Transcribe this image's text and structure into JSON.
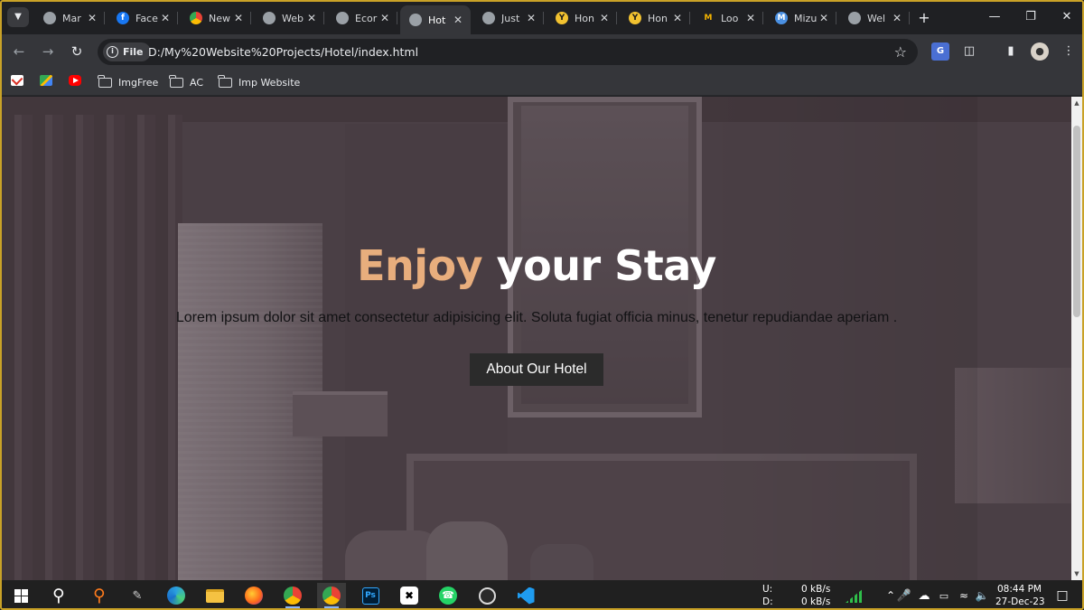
{
  "browser": {
    "tabs": [
      {
        "title": "Mar",
        "icon": "globe-icon",
        "active": false
      },
      {
        "title": "Face",
        "icon": "facebook-icon",
        "active": false
      },
      {
        "title": "New",
        "icon": "chrome-icon",
        "active": false
      },
      {
        "title": "Web",
        "icon": "globe-icon",
        "active": false
      },
      {
        "title": "Ecor",
        "icon": "globe-icon",
        "active": false
      },
      {
        "title": "Hot",
        "icon": "globe-icon",
        "active": true
      },
      {
        "title": "Just",
        "icon": "globe-icon",
        "active": false
      },
      {
        "title": "Hon",
        "icon": "y-logo-icon",
        "active": false
      },
      {
        "title": "Hon",
        "icon": "y-logo-icon",
        "active": false
      },
      {
        "title": "Loo",
        "icon": "m-logo-icon",
        "active": false
      },
      {
        "title": "Mizu",
        "icon": "m-circle-icon",
        "active": false
      },
      {
        "title": "Wel",
        "icon": "globe-icon",
        "active": false
      }
    ],
    "address": {
      "scheme_chip": "File",
      "url": "D:/My%20Website%20Projects/Hotel/index.html"
    },
    "bookmarks": [
      {
        "label": "ImgFree",
        "icon": "folder-icon"
      },
      {
        "label": "AC",
        "icon": "folder-icon"
      },
      {
        "label": "Imp Website",
        "icon": "folder-icon"
      }
    ],
    "bookmark_app_icons": [
      "gmail-icon",
      "google-maps-icon",
      "youtube-icon"
    ]
  },
  "page": {
    "hero": {
      "title_accent": "Enjoy",
      "title_rest": " your Stay",
      "subtitle": "Lorem ipsum dolor sit amet consectetur adipisicing elit. Soluta fugiat officia minus, tenetur repudiandae aperiam .",
      "button_label": "About Our Hotel"
    },
    "colors": {
      "accent": "#e8ae7d",
      "overlay": "#4d4449",
      "button_bg": "#2b2b2b"
    }
  },
  "taskbar": {
    "apps": [
      "start-icon",
      "search-icon",
      "magnifier-app-icon",
      "pen-icon",
      "edge-icon",
      "file-explorer-icon",
      "firefox-icon",
      "chrome-icon",
      "chrome-profile-icon",
      "photoshop-icon",
      "capcut-icon",
      "whatsapp-icon",
      "obs-icon",
      "vscode-icon"
    ],
    "network": {
      "upload_label": "U:",
      "download_label": "D:",
      "upload_value": "0 kB/s",
      "download_value": "0 kB/s"
    },
    "clock": {
      "time": "08:44 PM",
      "date": "27-Dec-23"
    }
  }
}
